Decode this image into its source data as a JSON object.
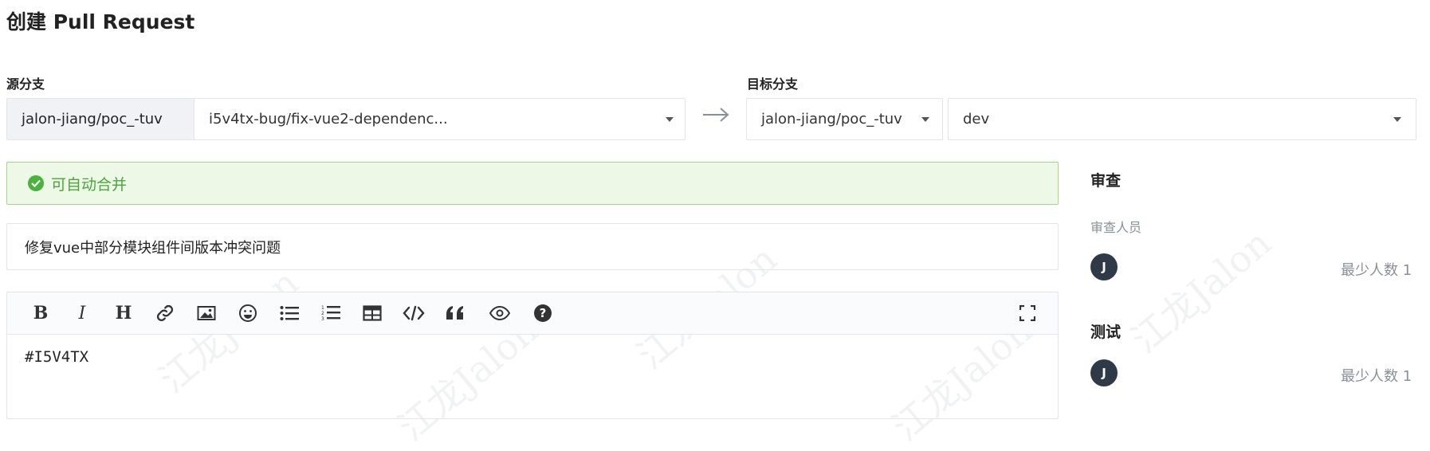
{
  "page": {
    "title": "创建 Pull Request"
  },
  "source": {
    "label": "源分支",
    "repo": "jalon-jiang/poc_-tuv",
    "branch": "i5v4tx-bug/fix-vue2-dependenc..."
  },
  "target": {
    "label": "目标分支",
    "repo": "jalon-jiang/poc_-tuv",
    "branch": "dev"
  },
  "merge_status": {
    "text": "可自动合并",
    "color": "#49b33b"
  },
  "pr_title": {
    "value": "修复vue中部分模块组件间版本冲突问题"
  },
  "editor": {
    "toolbar": [
      "bold-icon",
      "italic-icon",
      "heading-icon",
      "link-icon",
      "image-icon",
      "emoji-icon",
      "bullet-list-icon",
      "numbered-list-icon",
      "table-icon",
      "code-icon",
      "quote-icon",
      "preview-icon",
      "help-icon",
      "fullscreen-icon"
    ],
    "content": "#I5V4TX"
  },
  "review": {
    "title": "审查",
    "reviewers_label": "审查人员",
    "reviewer_avatar": "J",
    "min_count": "最少人数 1"
  },
  "test": {
    "title": "测试",
    "tester_avatar": "J",
    "min_count": "最少人数 1"
  },
  "watermark": {
    "text": "江龙Jalon"
  }
}
